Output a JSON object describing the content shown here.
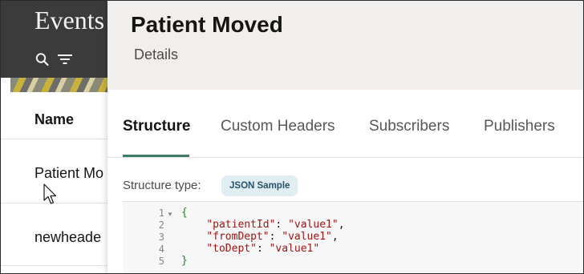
{
  "background": {
    "title": "Events",
    "icons": [
      "search-icon",
      "filter-icon"
    ],
    "list": {
      "column_header": "Name",
      "rows": [
        "Patient Mo",
        "newheade"
      ]
    }
  },
  "drawer": {
    "title": "Patient Moved",
    "subtitle": "Details",
    "tabs": [
      "Structure",
      "Custom Headers",
      "Subscribers",
      "Publishers"
    ],
    "active_tab": "Structure",
    "structure_type_label": "Structure type:",
    "structure_type_value": "JSON Sample",
    "code": {
      "line_numbers": [
        "1",
        "2",
        "3",
        "4",
        "5"
      ],
      "open_brace": "{",
      "lines": [
        {
          "key": "\"patientId\"",
          "value": "\"value1\"",
          "sep": ","
        },
        {
          "key": "\"fromDept\"",
          "value": "\"value1\"",
          "sep": ","
        },
        {
          "key": "\"toDept\"",
          "value": "\"value1\"",
          "sep": ""
        }
      ],
      "close_brace": "}"
    }
  },
  "colors": {
    "accent_underline": "#3f7e6b",
    "badge_bg": "#e0edf2",
    "badge_text": "#24536a",
    "json_brace": "#1e8a1e",
    "json_string": "#a31515"
  }
}
